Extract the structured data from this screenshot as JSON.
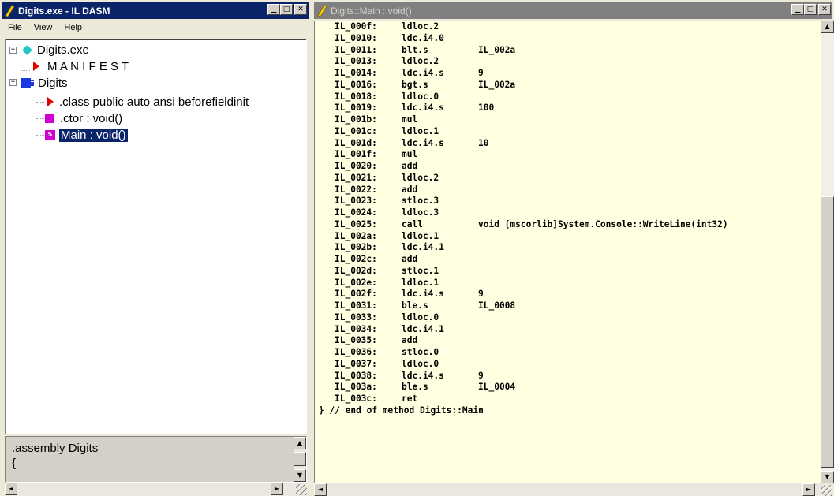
{
  "left_window": {
    "title": "Digits.exe - IL DASM",
    "menu": [
      "File",
      "View",
      "Help"
    ],
    "tree": {
      "root": "Digits.exe",
      "manifest": "M A N I F E S T",
      "class": "Digits",
      "class_decl": ".class public auto ansi beforefieldinit",
      "ctor": ".ctor : void()",
      "main": "Main : void()"
    },
    "info_pane": {
      "line1": ".assembly Digits",
      "line2": "{"
    }
  },
  "right_window": {
    "title": "Digits::Main : void()",
    "code": [
      {
        "label": "IL_000f:",
        "op": "ldloc.2",
        "arg": ""
      },
      {
        "label": "IL_0010:",
        "op": "ldc.i4.0",
        "arg": ""
      },
      {
        "label": "IL_0011:",
        "op": "blt.s",
        "arg": "IL_002a"
      },
      {
        "label": "IL_0013:",
        "op": "ldloc.2",
        "arg": ""
      },
      {
        "label": "IL_0014:",
        "op": "ldc.i4.s",
        "arg": "9"
      },
      {
        "label": "IL_0016:",
        "op": "bgt.s",
        "arg": "IL_002a"
      },
      {
        "label": "IL_0018:",
        "op": "ldloc.0",
        "arg": ""
      },
      {
        "label": "IL_0019:",
        "op": "ldc.i4.s",
        "arg": "100"
      },
      {
        "label": "IL_001b:",
        "op": "mul",
        "arg": ""
      },
      {
        "label": "IL_001c:",
        "op": "ldloc.1",
        "arg": ""
      },
      {
        "label": "IL_001d:",
        "op": "ldc.i4.s",
        "arg": "10"
      },
      {
        "label": "IL_001f:",
        "op": "mul",
        "arg": ""
      },
      {
        "label": "IL_0020:",
        "op": "add",
        "arg": ""
      },
      {
        "label": "IL_0021:",
        "op": "ldloc.2",
        "arg": ""
      },
      {
        "label": "IL_0022:",
        "op": "add",
        "arg": ""
      },
      {
        "label": "IL_0023:",
        "op": "stloc.3",
        "arg": ""
      },
      {
        "label": "IL_0024:",
        "op": "ldloc.3",
        "arg": ""
      },
      {
        "label": "IL_0025:",
        "op": "call",
        "arg": "void [mscorlib]System.Console::WriteLine(int32)"
      },
      {
        "label": "IL_002a:",
        "op": "ldloc.1",
        "arg": ""
      },
      {
        "label": "IL_002b:",
        "op": "ldc.i4.1",
        "arg": ""
      },
      {
        "label": "IL_002c:",
        "op": "add",
        "arg": ""
      },
      {
        "label": "IL_002d:",
        "op": "stloc.1",
        "arg": ""
      },
      {
        "label": "IL_002e:",
        "op": "ldloc.1",
        "arg": ""
      },
      {
        "label": "IL_002f:",
        "op": "ldc.i4.s",
        "arg": "9"
      },
      {
        "label": "IL_0031:",
        "op": "ble.s",
        "arg": "IL_0008"
      },
      {
        "label": "IL_0033:",
        "op": "ldloc.0",
        "arg": ""
      },
      {
        "label": "IL_0034:",
        "op": "ldc.i4.1",
        "arg": ""
      },
      {
        "label": "IL_0035:",
        "op": "add",
        "arg": ""
      },
      {
        "label": "IL_0036:",
        "op": "stloc.0",
        "arg": ""
      },
      {
        "label": "IL_0037:",
        "op": "ldloc.0",
        "arg": ""
      },
      {
        "label": "IL_0038:",
        "op": "ldc.i4.s",
        "arg": "9"
      },
      {
        "label": "IL_003a:",
        "op": "ble.s",
        "arg": "IL_0004"
      },
      {
        "label": "IL_003c:",
        "op": "ret",
        "arg": ""
      }
    ],
    "tail": "} // end of method Digits::Main"
  },
  "colors": {
    "active_title": "#0a246a",
    "inactive_title": "#808080",
    "code_background": "#ffffe1",
    "selection": "#0a246a"
  },
  "icons": {
    "app": "ildasm-icon",
    "root": "assembly-diamond-icon",
    "manifest": "manifest-triangle-icon",
    "class": "class-icon",
    "class_decl": "class-info-triangle-icon",
    "ctor": "method-icon",
    "main": "static-method-icon"
  }
}
